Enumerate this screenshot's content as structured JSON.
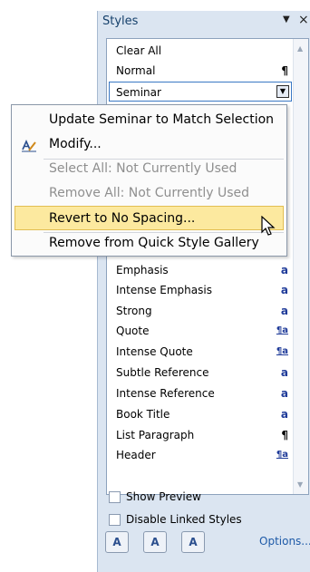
{
  "pane": {
    "title": "Styles",
    "menu_glyph": "▼",
    "close_glyph": "×"
  },
  "styles_list": {
    "top_items": [
      {
        "label": "Clear All",
        "mark": ""
      },
      {
        "label": "Normal",
        "mark": "¶"
      }
    ],
    "selected": {
      "label": "Seminar",
      "dropdown": "▼"
    },
    "items": [
      {
        "label": "Emphasis",
        "mark": "a"
      },
      {
        "label": "Intense Emphasis",
        "mark": "a"
      },
      {
        "label": "Strong",
        "mark": "a"
      },
      {
        "label": "Quote",
        "mark": "¶a"
      },
      {
        "label": "Intense Quote",
        "mark": "¶a"
      },
      {
        "label": "Subtle Reference",
        "mark": "a"
      },
      {
        "label": "Intense Reference",
        "mark": "a"
      },
      {
        "label": "Book Title",
        "mark": "a"
      },
      {
        "label": "List Paragraph",
        "mark": "¶"
      },
      {
        "label": "Header",
        "mark": "¶a"
      }
    ]
  },
  "context_menu": {
    "items": [
      {
        "label": "Update Seminar to Match Selection",
        "state": "enabled"
      },
      {
        "label": "Modify...",
        "state": "enabled",
        "icon": "modify-style-icon"
      },
      {
        "label": "Select All: Not Currently Used",
        "state": "disabled"
      },
      {
        "label": "Remove All: Not Currently Used",
        "state": "disabled"
      },
      {
        "label": "Revert to No Spacing...",
        "state": "highlighted"
      },
      {
        "label": "Remove from Quick Style Gallery",
        "state": "enabled"
      }
    ],
    "highlight_color": "#fce99f"
  },
  "footer": {
    "show_preview": "Show Preview",
    "disable_linked": "Disable Linked Styles",
    "buttons": [
      {
        "icon": "new-style-icon",
        "glyph": "A"
      },
      {
        "icon": "style-inspector-icon",
        "glyph": "A"
      },
      {
        "icon": "manage-styles-icon",
        "glyph": "A"
      }
    ],
    "options_label": "Options..."
  }
}
